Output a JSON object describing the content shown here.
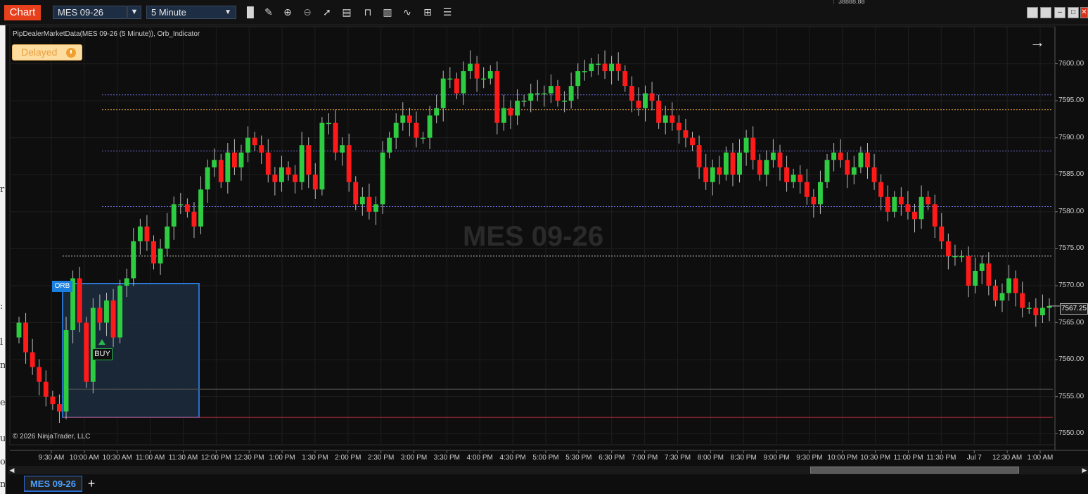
{
  "toolbar": {
    "app_tab": "Chart",
    "instrument": "MES 09-26",
    "period": "5 Minute",
    "top_right_value": "38888.88"
  },
  "chart": {
    "indicator_label": "PipDealerMarketData(MES 09-26 (5 Minute)), Orb_Indicator",
    "delayed_label": "Delayed",
    "watermark": "MES 09-26",
    "copyright": "© 2026 NinjaTrader, LLC",
    "orb_label": "ORB",
    "buy_label": "BUY",
    "last_price": "7567.25"
  },
  "chart_data": {
    "type": "candlestick",
    "title": "",
    "y_ticks": [
      "7600.00",
      "7595.00",
      "7590.00",
      "7585.00",
      "7580.00",
      "7575.00",
      "7570.00",
      "7565.00",
      "7560.00",
      "7555.00",
      "7550.00"
    ],
    "ylim": [
      7548.5,
      7605.0
    ],
    "x_ticks": [
      "9:30 AM",
      "10:00 AM",
      "10:30 AM",
      "11:00 AM",
      "11:30 AM",
      "12:00 PM",
      "12:30 PM",
      "1:00 PM",
      "1:30 PM",
      "2:00 PM",
      "2:30 PM",
      "3:00 PM",
      "3:30 PM",
      "4:00 PM",
      "4:30 PM",
      "5:00 PM",
      "5:30 PM",
      "6:30 PM",
      "7:00 PM",
      "7:30 PM",
      "8:00 PM",
      "8:30 PM",
      "9:00 PM",
      "9:30 PM",
      "10:00 PM",
      "10:30 PM",
      "11:00 PM",
      "11:30 PM",
      "Jul 7",
      "12:30 AM",
      "1:00 AM"
    ],
    "levels": [
      {
        "price": 7595.8,
        "color": "#6b6bd6",
        "style": "dotted"
      },
      {
        "price": 7593.8,
        "color": "#e6a23c",
        "style": "dotted"
      },
      {
        "price": 7588.2,
        "color": "#6b6bd6",
        "style": "dotted"
      },
      {
        "price": 7580.7,
        "color": "#6b6bd6",
        "style": "dotted"
      },
      {
        "price": 7574.0,
        "color": "#bbbbbb",
        "style": "dotted"
      },
      {
        "price": 7556.0,
        "color": "#555555",
        "style": "solid"
      },
      {
        "price": 7552.2,
        "color": "#c03040",
        "style": "solid"
      }
    ],
    "orb_box": {
      "high": 7570.3,
      "low": 7552.2
    },
    "last_price": 7567.25,
    "bull_color": "#2ecc40",
    "bear_color": "#ff1a1a",
    "closes": [
      7565,
      7561,
      7559,
      7557,
      7555,
      7554,
      7553,
      7564,
      7571,
      7565,
      7557,
      7567,
      7565,
      7568,
      7563,
      7570,
      7571,
      7576,
      7578,
      7576,
      7573,
      7575,
      7578,
      7581,
      7581,
      7580,
      7578,
      7583,
      7586,
      7587,
      7584,
      7588,
      7586,
      7588,
      7590,
      7589,
      7588,
      7585,
      7584,
      7586,
      7585,
      7584,
      7589,
      7585,
      7583,
      7592,
      7592,
      7588,
      7589,
      7584,
      7581,
      7582,
      7580,
      7581,
      7588,
      7590,
      7592,
      7593,
      7592,
      7590,
      7590,
      7593,
      7594,
      7598,
      7598,
      7596,
      7599,
      7600,
      7598,
      7598,
      7599,
      7592,
      7594,
      7593,
      7595,
      7595,
      7596,
      7596,
      7596,
      7597,
      7595,
      7595,
      7597,
      7599,
      7599,
      7600,
      7600,
      7599,
      7600,
      7599,
      7597,
      7595,
      7594,
      7596,
      7595,
      7592,
      7593,
      7592,
      7591,
      7590,
      7589,
      7586,
      7584,
      7586,
      7585,
      7588,
      7585,
      7588,
      7590,
      7587,
      7585,
      7587,
      7588,
      7586,
      7584,
      7585,
      7584,
      7582,
      7581,
      7584,
      7587,
      7588,
      7587,
      7585,
      7586,
      7588,
      7586,
      7584,
      7582,
      7580,
      7582,
      7581,
      7580,
      7579,
      7582,
      7581,
      7578,
      7576,
      7574,
      7574,
      7574,
      7570,
      7572,
      7573,
      7570,
      7568,
      7569,
      7571,
      7569,
      7567,
      7567,
      7566,
      7567,
      7567.25
    ],
    "opens": [
      7563,
      7565,
      7561,
      7559,
      7557,
      7555,
      7554,
      7553,
      7564,
      7571,
      7565,
      7557,
      7567,
      7565,
      7568,
      7563,
      7570,
      7571,
      7576,
      7578,
      7576,
      7573,
      7575,
      7578,
      7581,
      7581,
      7580,
      7578,
      7583,
      7586,
      7587,
      7584,
      7588,
      7586,
      7588,
      7590,
      7589,
      7588,
      7585,
      7584,
      7586,
      7585,
      7584,
      7589,
      7585,
      7583,
      7592,
      7592,
      7588,
      7589,
      7584,
      7581,
      7582,
      7580,
      7581,
      7588,
      7590,
      7592,
      7593,
      7592,
      7590,
      7590,
      7593,
      7594,
      7598,
      7598,
      7596,
      7599,
      7600,
      7598,
      7598,
      7599,
      7592,
      7594,
      7593,
      7595,
      7595,
      7596,
      7596,
      7596,
      7597,
      7595,
      7595,
      7597,
      7599,
      7599,
      7600,
      7600,
      7599,
      7600,
      7599,
      7597,
      7595,
      7594,
      7596,
      7595,
      7592,
      7593,
      7592,
      7591,
      7590,
      7589,
      7586,
      7584,
      7586,
      7585,
      7588,
      7585,
      7588,
      7590,
      7587,
      7585,
      7587,
      7588,
      7586,
      7584,
      7585,
      7584,
      7582,
      7581,
      7584,
      7587,
      7588,
      7587,
      7585,
      7586,
      7588,
      7586,
      7584,
      7582,
      7580,
      7582,
      7581,
      7580,
      7579,
      7582,
      7581,
      7578,
      7576,
      7574,
      7574,
      7574,
      7570,
      7572,
      7573,
      7570,
      7568,
      7569,
      7571,
      7569,
      7567,
      7567,
      7566,
      7567
    ]
  }
}
